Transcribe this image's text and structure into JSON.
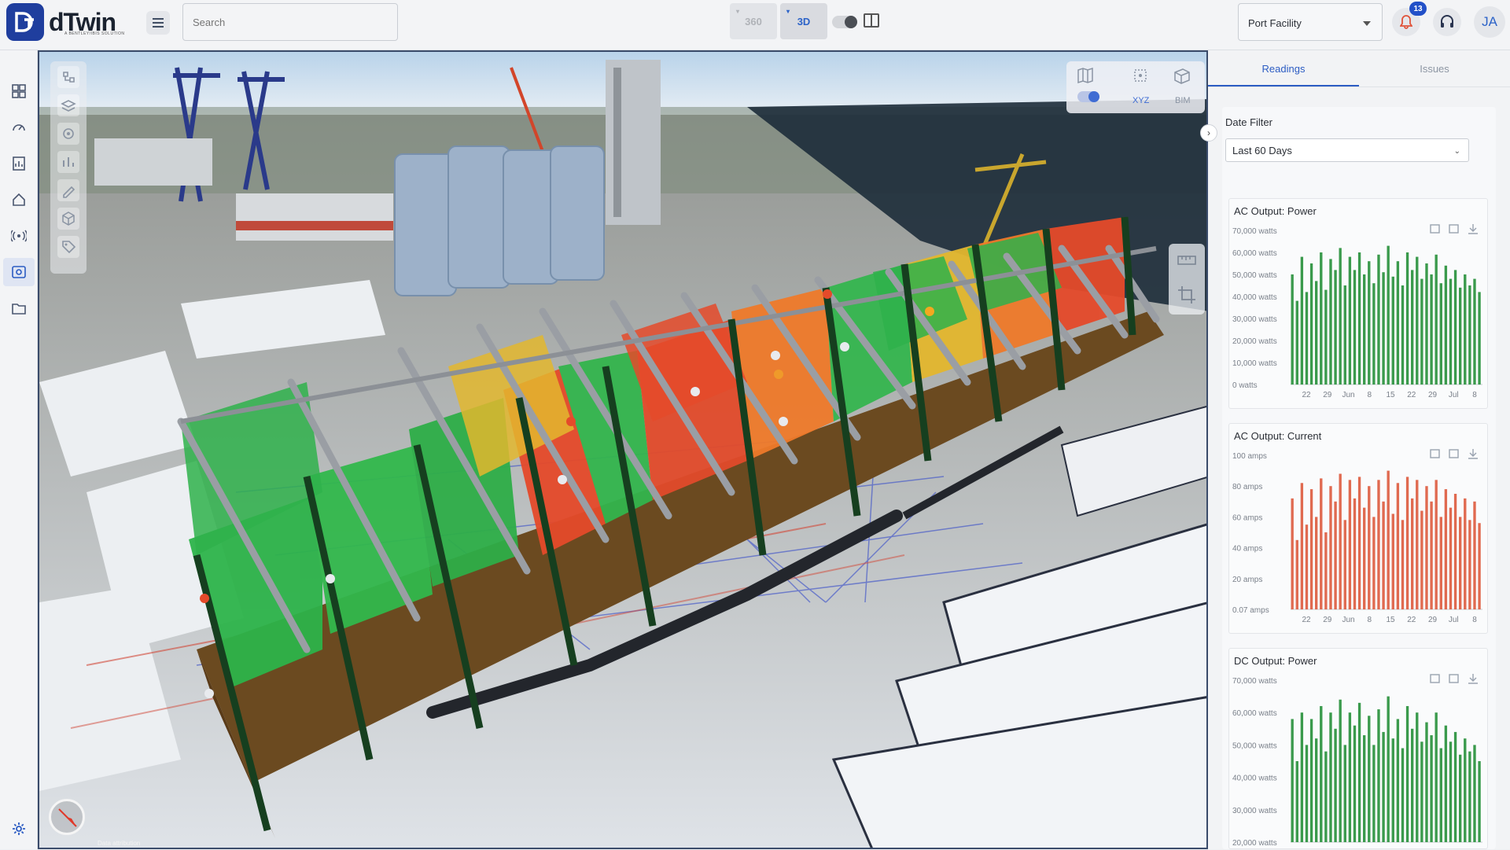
{
  "header": {
    "brand": "dTwin",
    "brand_sub": "A BENTLEY/IBIS SOLUTION",
    "search_placeholder": "Search",
    "view_360": "360",
    "view_3d": "3D",
    "facility": "Port Facility",
    "notifications": "13",
    "avatar_initials": "JA"
  },
  "sidebar": {
    "items": [
      "dashboard-icon",
      "gauge-icon",
      "report-icon",
      "home-icon",
      "sensor-icon",
      "viewer-icon",
      "folder-icon"
    ],
    "active": "viewer-icon"
  },
  "viewport": {
    "toolbar_labels": {
      "xyz": "XYZ",
      "bim": "BIM"
    },
    "attribution": "Data attribution"
  },
  "panel": {
    "tabs": [
      {
        "label": "Readings",
        "active": true
      },
      {
        "label": "Issues",
        "active": false
      }
    ],
    "date_filter_label": "Date Filter",
    "date_filter_value": "Last 60 Days"
  },
  "colors": {
    "brand": "#1f3e9e",
    "accent": "#2c5cc3",
    "power_series": "#3a9a4c",
    "current_series": "#e06a50",
    "green_bay": "#2db34a",
    "red_bay": "#e54a2a",
    "orange_bay": "#ef7a2a",
    "yellow_bay": "#e3b72e"
  },
  "chart_data": [
    {
      "type": "bar",
      "title": "AC Output: Power",
      "ylim": [
        0,
        70000
      ],
      "yticks": [
        "70,000 watts",
        "60,000 watts",
        "50,000 watts",
        "40,000 watts",
        "30,000 watts",
        "20,000 watts",
        "10,000 watts",
        "0 watts"
      ],
      "xticks": [
        "22",
        "29",
        "Jun",
        "8",
        "15",
        "22",
        "29",
        "Jul",
        "8"
      ],
      "values": [
        50000,
        38000,
        58000,
        42000,
        55000,
        47000,
        60000,
        43000,
        57000,
        52000,
        62000,
        45000,
        58000,
        52000,
        60000,
        50000,
        56000,
        46000,
        59000,
        51000,
        63000,
        49000,
        56000,
        45000,
        60000,
        52000,
        58000,
        48000,
        55000,
        50000,
        59000,
        46000,
        54000,
        48000,
        52000,
        44000,
        50000,
        45000,
        48000,
        42000
      ]
    },
    {
      "type": "bar",
      "title": "AC Output: Current",
      "ylim": [
        0,
        100
      ],
      "yticks": [
        "100 amps",
        "80 amps",
        "60 amps",
        "40 amps",
        "20 amps",
        "0.07 amps"
      ],
      "xticks": [
        "22",
        "29",
        "Jun",
        "8",
        "15",
        "22",
        "29",
        "Jul",
        "8"
      ],
      "values": [
        72,
        45,
        82,
        55,
        78,
        60,
        85,
        50,
        80,
        70,
        88,
        58,
        84,
        72,
        86,
        66,
        80,
        60,
        84,
        70,
        90,
        62,
        82,
        58,
        86,
        72,
        84,
        64,
        80,
        70,
        84,
        60,
        78,
        66,
        75,
        60,
        72,
        58,
        70,
        56
      ]
    },
    {
      "type": "bar",
      "title": "DC Output: Power",
      "ylim": [
        20000,
        70000
      ],
      "yticks": [
        "70,000 watts",
        "60,000 watts",
        "50,000 watts",
        "40,000 watts",
        "30,000 watts",
        "20,000 watts"
      ],
      "xticks": [],
      "values": [
        58000,
        45000,
        60000,
        50000,
        58000,
        52000,
        62000,
        48000,
        60000,
        55000,
        64000,
        50000,
        60000,
        56000,
        63000,
        53000,
        59000,
        50000,
        61000,
        54000,
        65000,
        52000,
        58000,
        49000,
        62000,
        55000,
        60000,
        51000,
        57000,
        53000,
        60000,
        49000,
        56000,
        51000,
        54000,
        47000,
        52000,
        48000,
        50000,
        45000
      ]
    }
  ]
}
